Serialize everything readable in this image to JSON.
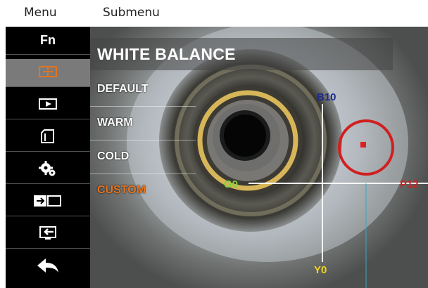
{
  "captions": {
    "menu": "Menu",
    "submenu": "Submenu"
  },
  "menu": {
    "items": [
      {
        "label": "Fn",
        "icon": "fn-text",
        "selected": false
      },
      {
        "label": "",
        "icon": "white-balance-icon",
        "selected": true
      },
      {
        "label": "",
        "icon": "playback-icon",
        "selected": false
      },
      {
        "label": "",
        "icon": "memory-card-icon",
        "selected": false
      },
      {
        "label": "",
        "icon": "settings-gears-icon",
        "selected": false
      },
      {
        "label": "",
        "icon": "usb-connect-icon",
        "selected": false
      },
      {
        "label": "",
        "icon": "export-icon",
        "selected": false
      },
      {
        "label": "",
        "icon": "back-arrow-icon",
        "selected": false
      }
    ]
  },
  "submenu": {
    "title": "WHITE BALANCE",
    "options": [
      {
        "label": "DEFAULT",
        "active": false
      },
      {
        "label": "WARM",
        "active": false
      },
      {
        "label": "COLD",
        "active": false
      },
      {
        "label": "CUSTOM",
        "active": true
      }
    ]
  },
  "overlay": {
    "labels": {
      "b": "B10",
      "g": "G0",
      "p": "P12",
      "y": "Y0"
    },
    "colors": {
      "accent": "#e2741f",
      "b": "#1d2a8c",
      "g": "#7fd23a",
      "p": "#d11f1f",
      "y": "#f2d21a",
      "marker": "#e02020"
    }
  }
}
